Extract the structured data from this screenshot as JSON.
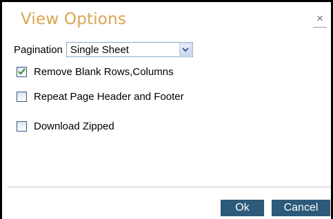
{
  "dialog": {
    "title": "View Options",
    "close_label": "×"
  },
  "pagination": {
    "label": "Pagination",
    "selected": "Single Sheet"
  },
  "options": [
    {
      "label": "Remove Blank Rows,Columns",
      "checked": true
    },
    {
      "label": "Repeat Page Header and Footer",
      "checked": false
    },
    {
      "label": "Download Zipped",
      "checked": false
    }
  ],
  "buttons": {
    "ok_label": "Ok",
    "cancel_label": "Cancel"
  },
  "colors": {
    "title": "#e3a34a",
    "button_bg": "#2d5a7b",
    "check": "#2a8a2a"
  }
}
